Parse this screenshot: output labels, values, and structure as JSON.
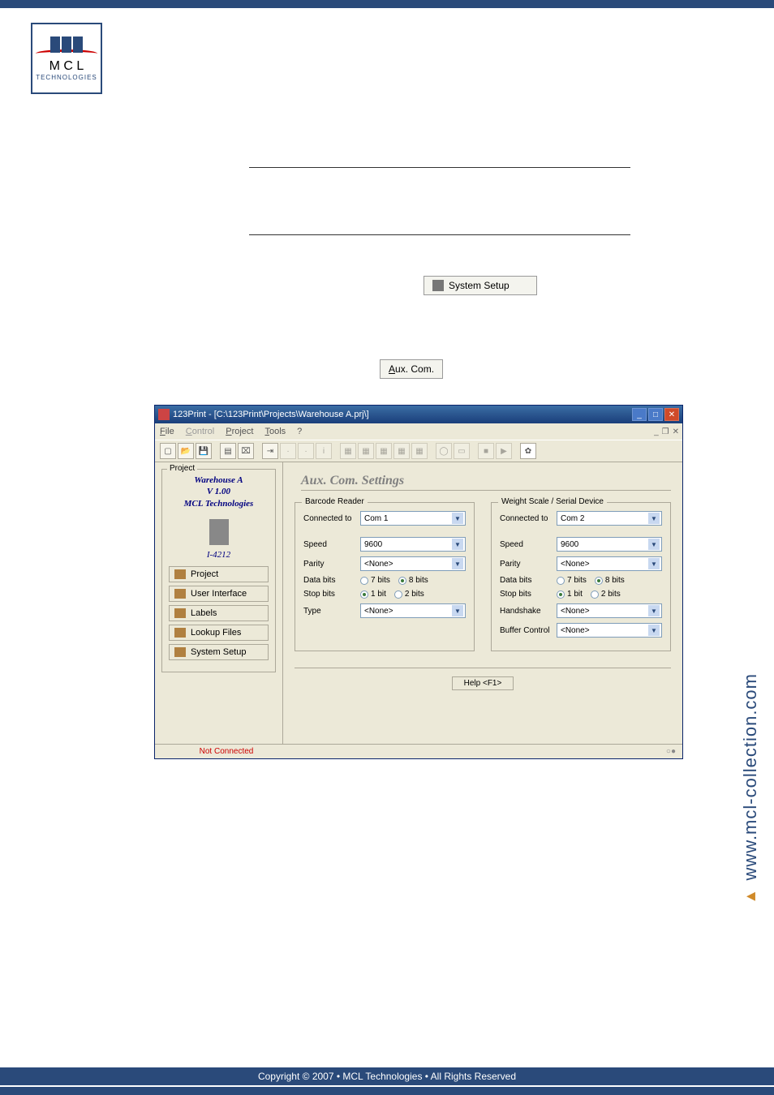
{
  "logo_text": "TECHNOLOGIES",
  "buttons": {
    "system_setup": "System Setup",
    "aux_com": "Aux. Com."
  },
  "app": {
    "title": "123Print - [C:\\123Print\\Projects\\Warehouse A.prj\\]",
    "menu": {
      "file": "File",
      "control": "Control",
      "project": "Project",
      "tools": "Tools",
      "help": "?"
    },
    "sidebar": {
      "group_label": "Project",
      "project_name": "Warehouse A",
      "version": "V 1.00",
      "company": "MCL Technologies",
      "device": "I-4212",
      "nav": [
        "Project",
        "User Interface",
        "Labels",
        "Lookup Files",
        "System Setup"
      ]
    },
    "content": {
      "heading": "Aux. Com. Settings",
      "barcode": {
        "legend": "Barcode Reader",
        "connected_label": "Connected to",
        "connected": "Com 1",
        "speed_label": "Speed",
        "speed": "9600",
        "parity_label": "Parity",
        "parity": "<None>",
        "databits_label": "Data bits",
        "db7": "7 bits",
        "db8": "8 bits",
        "stopbits_label": "Stop bits",
        "sb1": "1 bit",
        "sb2": "2 bits",
        "type_label": "Type",
        "type": "<None>"
      },
      "scale": {
        "legend": "Weight Scale / Serial Device",
        "connected_label": "Connected to",
        "connected": "Com 2",
        "speed_label": "Speed",
        "speed": "9600",
        "parity_label": "Parity",
        "parity": "<None>",
        "databits_label": "Data bits",
        "db7": "7 bits",
        "db8": "8 bits",
        "stopbits_label": "Stop bits",
        "sb1": "1 bit",
        "sb2": "2 bits",
        "handshake_label": "Handshake",
        "handshake": "<None>",
        "buffer_label": "Buffer Control",
        "buffer": "<None>"
      },
      "help_btn": "Help <F1>"
    },
    "status": {
      "not_connected": "Not Connected",
      "indicator": "○●"
    }
  },
  "side_url": "www.mcl-collection.com",
  "copyright": "Copyright © 2007 • MCL Technologies • All Rights Reserved"
}
